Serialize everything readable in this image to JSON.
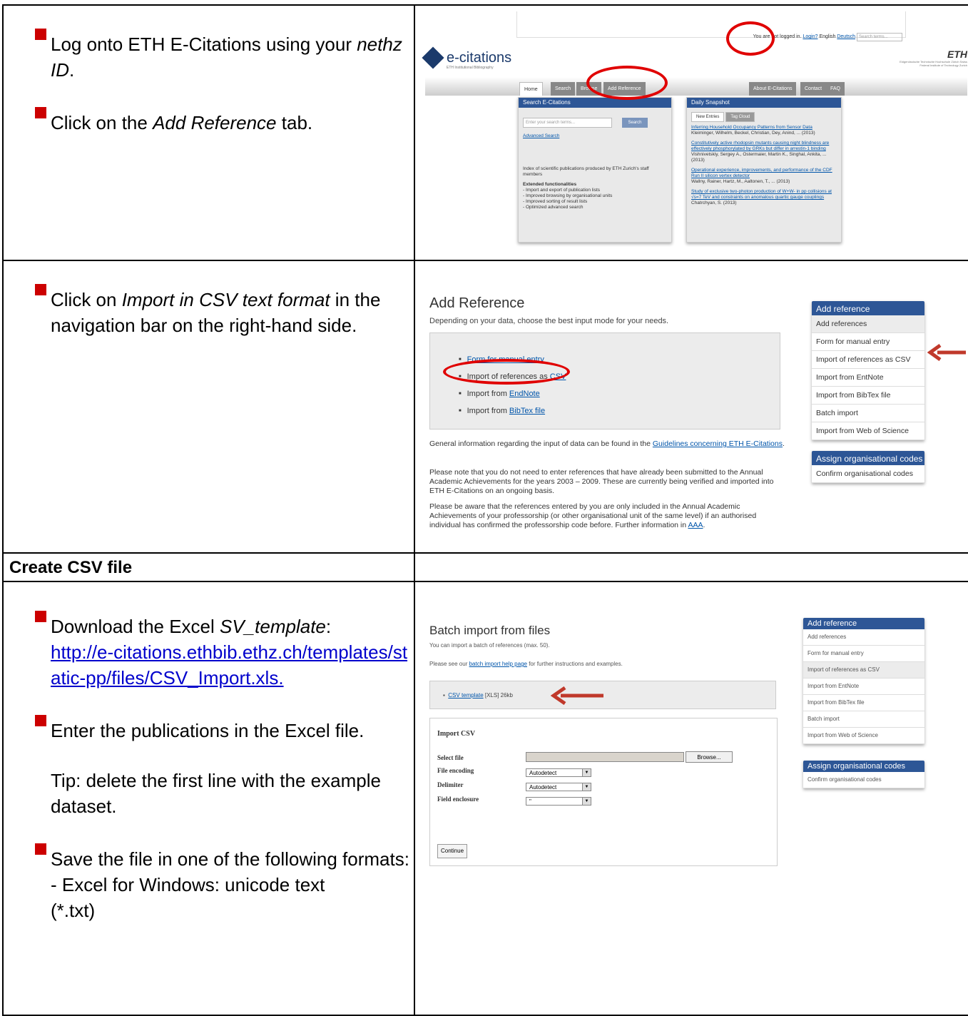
{
  "section1": {
    "bullets": [
      {
        "text_before": "Log onto ETH E-Citations using your ",
        "italic": "nethz ID",
        "text_after": "."
      },
      {
        "text_before": "Click on the ",
        "italic": "Add Reference",
        "text_after": " tab."
      }
    ],
    "screenshot": {
      "topbar": {
        "not_logged": "You are not logged in.",
        "login": "Login?",
        "lang_en": "English",
        "lang_de": "Deutsch",
        "search_placeholder": "Search terms..."
      },
      "logo_text": "e-citations",
      "logo_sub": "ETH Institutional Bibliography",
      "eth_logo": "ETH",
      "eth_sub": "Eidgenössische Technische Hochschule Zürich Swiss Federal Institute of Technology Zurich",
      "nav_tabs": [
        "Home",
        "Search",
        "Browse",
        "Add Reference",
        "About E-Citations",
        "Contact",
        "FAQ"
      ],
      "search_panel": {
        "title": "Search E-Citations",
        "input_placeholder": "Enter your search terms...",
        "button": "Search",
        "advanced": "Advanced Search",
        "desc": "Index of scientific publications produced by ETH Zurich's staff members",
        "ext_title": "Extended functionalities",
        "ext_items": [
          "- Import and export of publication lists",
          "- Improved browsing by organisational units",
          "- Improved sorting of result lists",
          "- Optimized advanced search"
        ]
      },
      "snapshot_panel": {
        "title": "Daily Snapshot",
        "tabs": [
          "New Entries",
          "Tag Cloud"
        ],
        "entries": [
          {
            "title": "Inferring Household Occupancy Patterns from Sensor Data",
            "authors": "Kleiminger, Wilhelm, Beckel, Christian, Dey, Anind, ... (2013)"
          },
          {
            "title": "Constitutively active rhodopsin mutants causing night blindness are effectively phosphorylated by GRKs but differ in arrestin-1 binding",
            "authors": "Vishnivetskiy, Sergey A., Ostermaier, Martin K., Singhal, Ankita, ... (2013)"
          },
          {
            "title": "Operational experience, improvements, and performance of the CDF Run II silicon vertex detector",
            "authors": "Wallny, Rainer, Hartz, M., Aaltonen, T., ... (2013)"
          },
          {
            "title": "Study of exclusive two-photon production of W+W- in pp collisions at √s=7 TeV and constraints on anomalous quartic gauge couplings",
            "authors": "Chatrchyan, S. (2013)"
          }
        ]
      }
    }
  },
  "section2": {
    "bullet": {
      "text_before": "Click on ",
      "italic": "Import in CSV text format",
      "text_after": " in the navigation bar on the right-hand side."
    },
    "screenshot": {
      "title": "Add Reference",
      "subtitle": "Depending on your data, choose the best input mode for your needs.",
      "options": [
        {
          "label": "Form for manual entry",
          "link": ""
        },
        {
          "label": "Import of references as ",
          "link": "CSV"
        },
        {
          "label": "Import from ",
          "link": "EndNote"
        },
        {
          "label": "Import from ",
          "link": "BibTex file"
        }
      ],
      "para1_before": "General information regarding the input of data can be found in the ",
      "para1_link": "Guidelines concerning ETH E-Citations",
      "para1_after": ".",
      "para2": "Please note that you do not need to enter references that have already been submitted to the Annual Academic Achievements for the years 2003 – 2009. These are currently being verified and imported into ETH E-Citations on an ongoing basis.",
      "para3_before": "Please be aware that the references entered by you are only included in the Annual Academic Achievements of your professorship (or other organisational unit of the same level) if an authorised individual has confirmed the professorship code before. Further information in ",
      "para3_link": "AAA",
      "para3_after": ".",
      "sidenav_title": "Add reference",
      "sidenav_items": [
        "Add references",
        "Form for manual entry",
        "Import of references as CSV",
        "Import from EntNote",
        "Import from BibTex file",
        "Batch import",
        "Import from Web of Science"
      ],
      "assign_title": "Assign organisational codes",
      "assign_items": [
        "Confirm organisational codes"
      ]
    }
  },
  "header_row": {
    "label": "Create CSV file"
  },
  "section3": {
    "bullets": [
      {
        "text_before": "Download the Excel ",
        "italic": "SV_template",
        "text_after": ":",
        "link": "http://e-citations.ethbib.ethz.ch/templates/static-pp/files/CSV_Import.xls."
      },
      {
        "text": "Enter the publications in the Excel file."
      },
      {
        "text": "Tip: delete the first line with the example dataset."
      },
      {
        "text": "Save the file in one of the following formats:",
        "line2": "- Excel for Windows: unicode text",
        "line3": "(*.txt)"
      }
    ],
    "screenshot": {
      "title": "Batch import from files",
      "subtitle": "You can import a batch of references (max. 50).",
      "help_before": "Please see our ",
      "help_link": "batch import help page",
      "help_after": " for further instructions and examples.",
      "template_link": "CSV template",
      "template_meta": " [XLS] 26kb",
      "form_title": "Import CSV",
      "fields": [
        {
          "label": "Select file",
          "value": ""
        },
        {
          "label": "File encoding",
          "value": "Autodetect"
        },
        {
          "label": "Delimiter",
          "value": "Autodetect"
        },
        {
          "label": "Field enclosure",
          "value": "\""
        }
      ],
      "browse": "Browse...",
      "continue": "Continue",
      "sidenav_title": "Add reference",
      "sidenav_items": [
        "Add references",
        "Form for manual entry",
        "Import of references as CSV",
        "Import from EntNote",
        "Import from BibTex file",
        "Batch import",
        "Import from Web of Science"
      ],
      "assign_title": "Assign organisational codes",
      "assign_items": [
        "Confirm organisational codes"
      ]
    }
  }
}
